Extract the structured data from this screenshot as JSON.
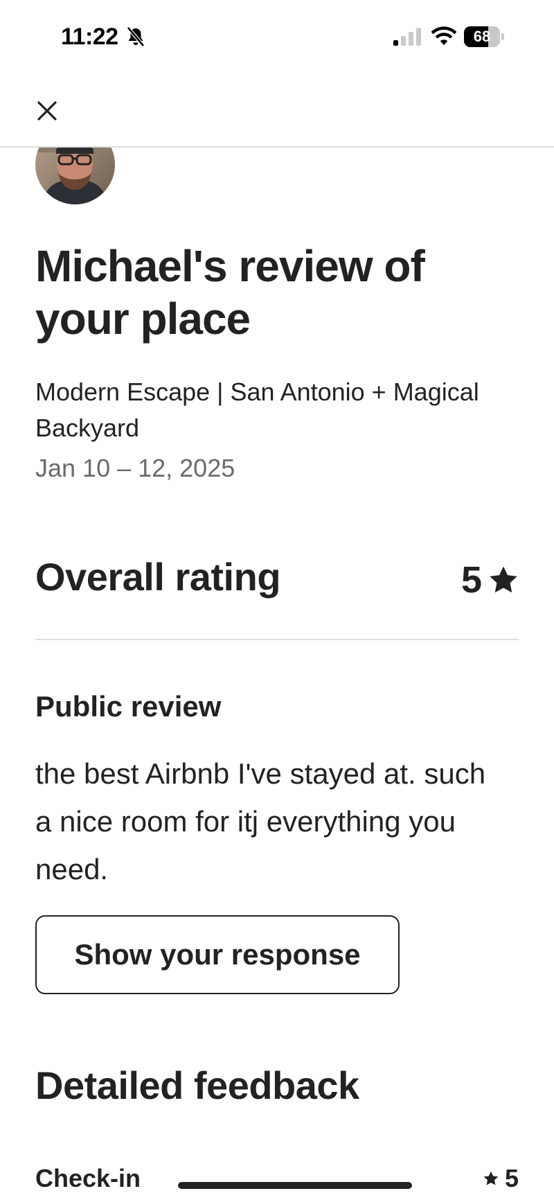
{
  "status_bar": {
    "time": "11:22",
    "battery_level": "68",
    "battery_fraction": 0.68,
    "cellular_bars_active": 1,
    "cellular_bars_total": 4
  },
  "header": {
    "close_icon": "close-icon"
  },
  "review": {
    "title": "Michael's review of your place",
    "listing_name": "Modern Escape | San Antonio + Magical Backyard",
    "dates": "Jan 10 – 12, 2025",
    "overall_label": "Overall rating",
    "overall_value": "5",
    "public_heading": "Public review",
    "public_text": "the best Airbnb I've stayed at. such a nice room for itj everything you need.",
    "response_button": "Show your response",
    "detailed_heading": "Detailed feedback",
    "feedback": [
      {
        "label": "Check-in",
        "value": "5",
        "fraction": 1.0
      }
    ]
  },
  "colors": {
    "text": "#222222",
    "muted": "#6a6a6a",
    "divider": "#dddddd"
  }
}
